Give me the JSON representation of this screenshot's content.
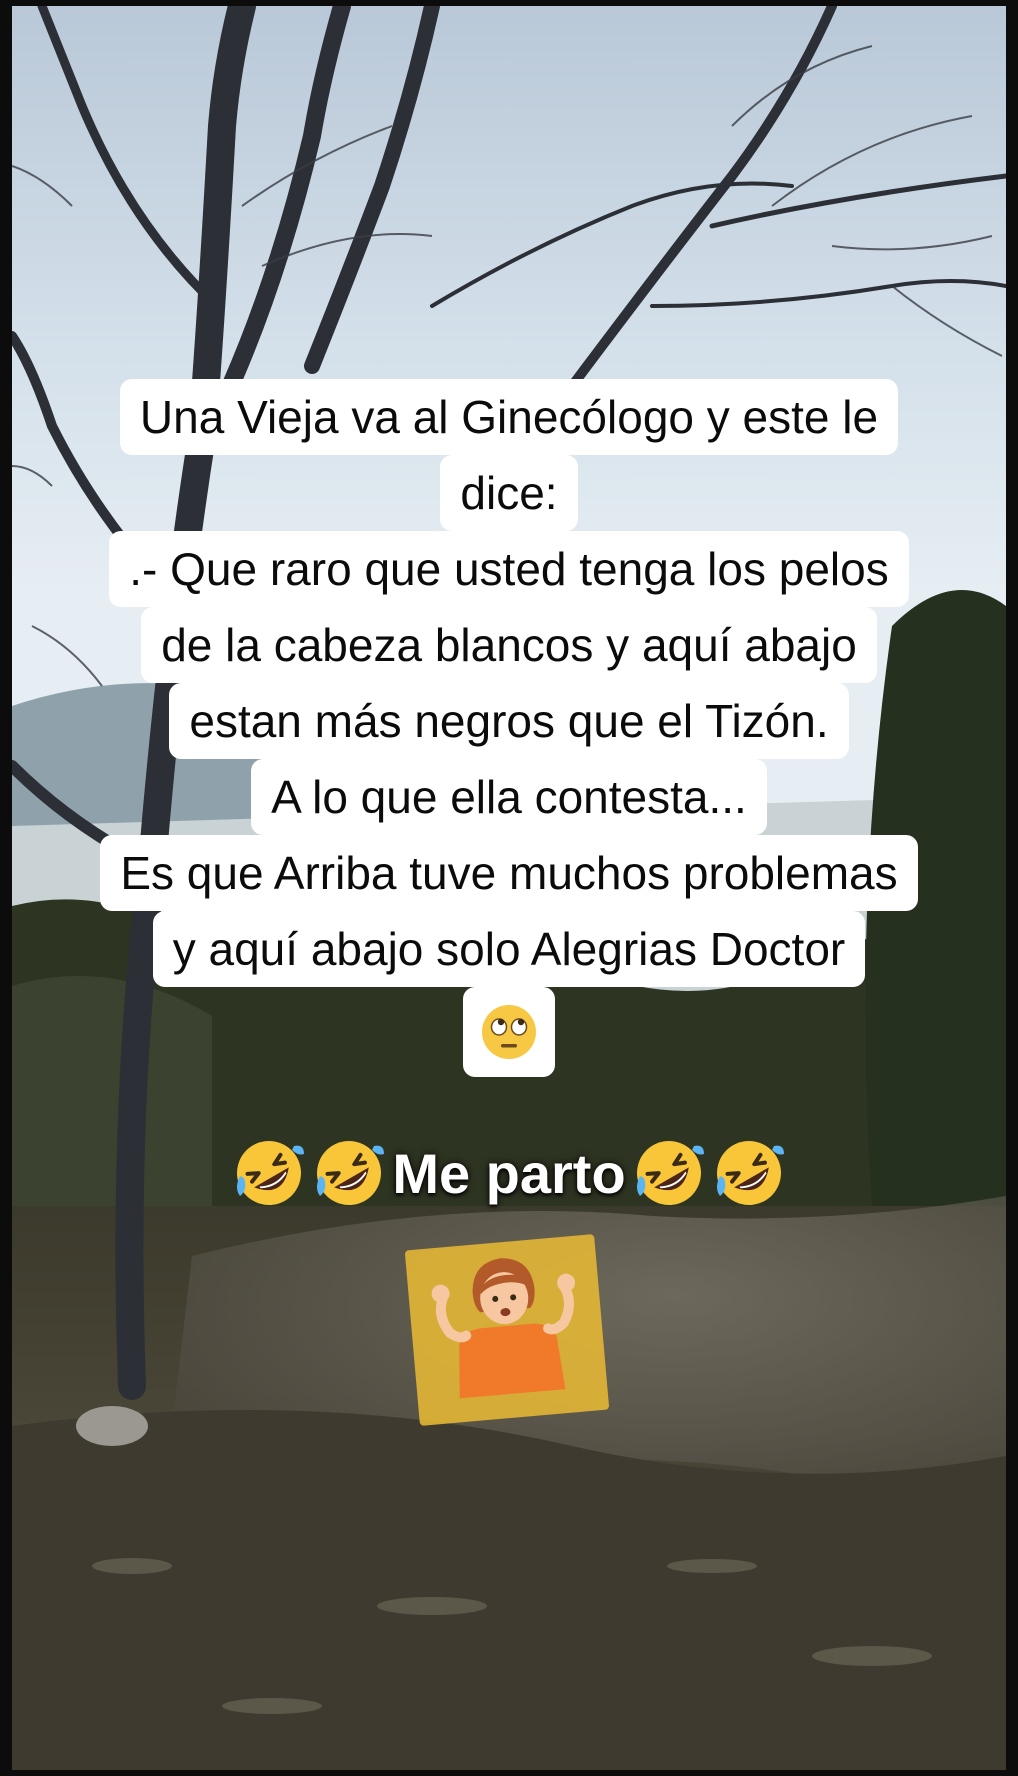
{
  "caption": {
    "lines": [
      "Una Vieja va al Ginecólogo y este le",
      "dice:",
      ".- Que raro que usted tenga los pelos",
      "de la cabeza blancos y aquí abajo",
      "estan más negros que el Tizón.",
      "A lo que ella contesta...",
      "Es que Arriba tuve muchos problemas",
      "y aquí abajo solo Alegrias Doctor"
    ],
    "end_emoji": "eye-roll-face-emoji"
  },
  "overlay": {
    "text": "Me parto",
    "emoji": "rolling-on-floor-laughing-emoji"
  },
  "sticker": {
    "emoji": "person-shrugging-emoji",
    "color": "#e6b834"
  }
}
